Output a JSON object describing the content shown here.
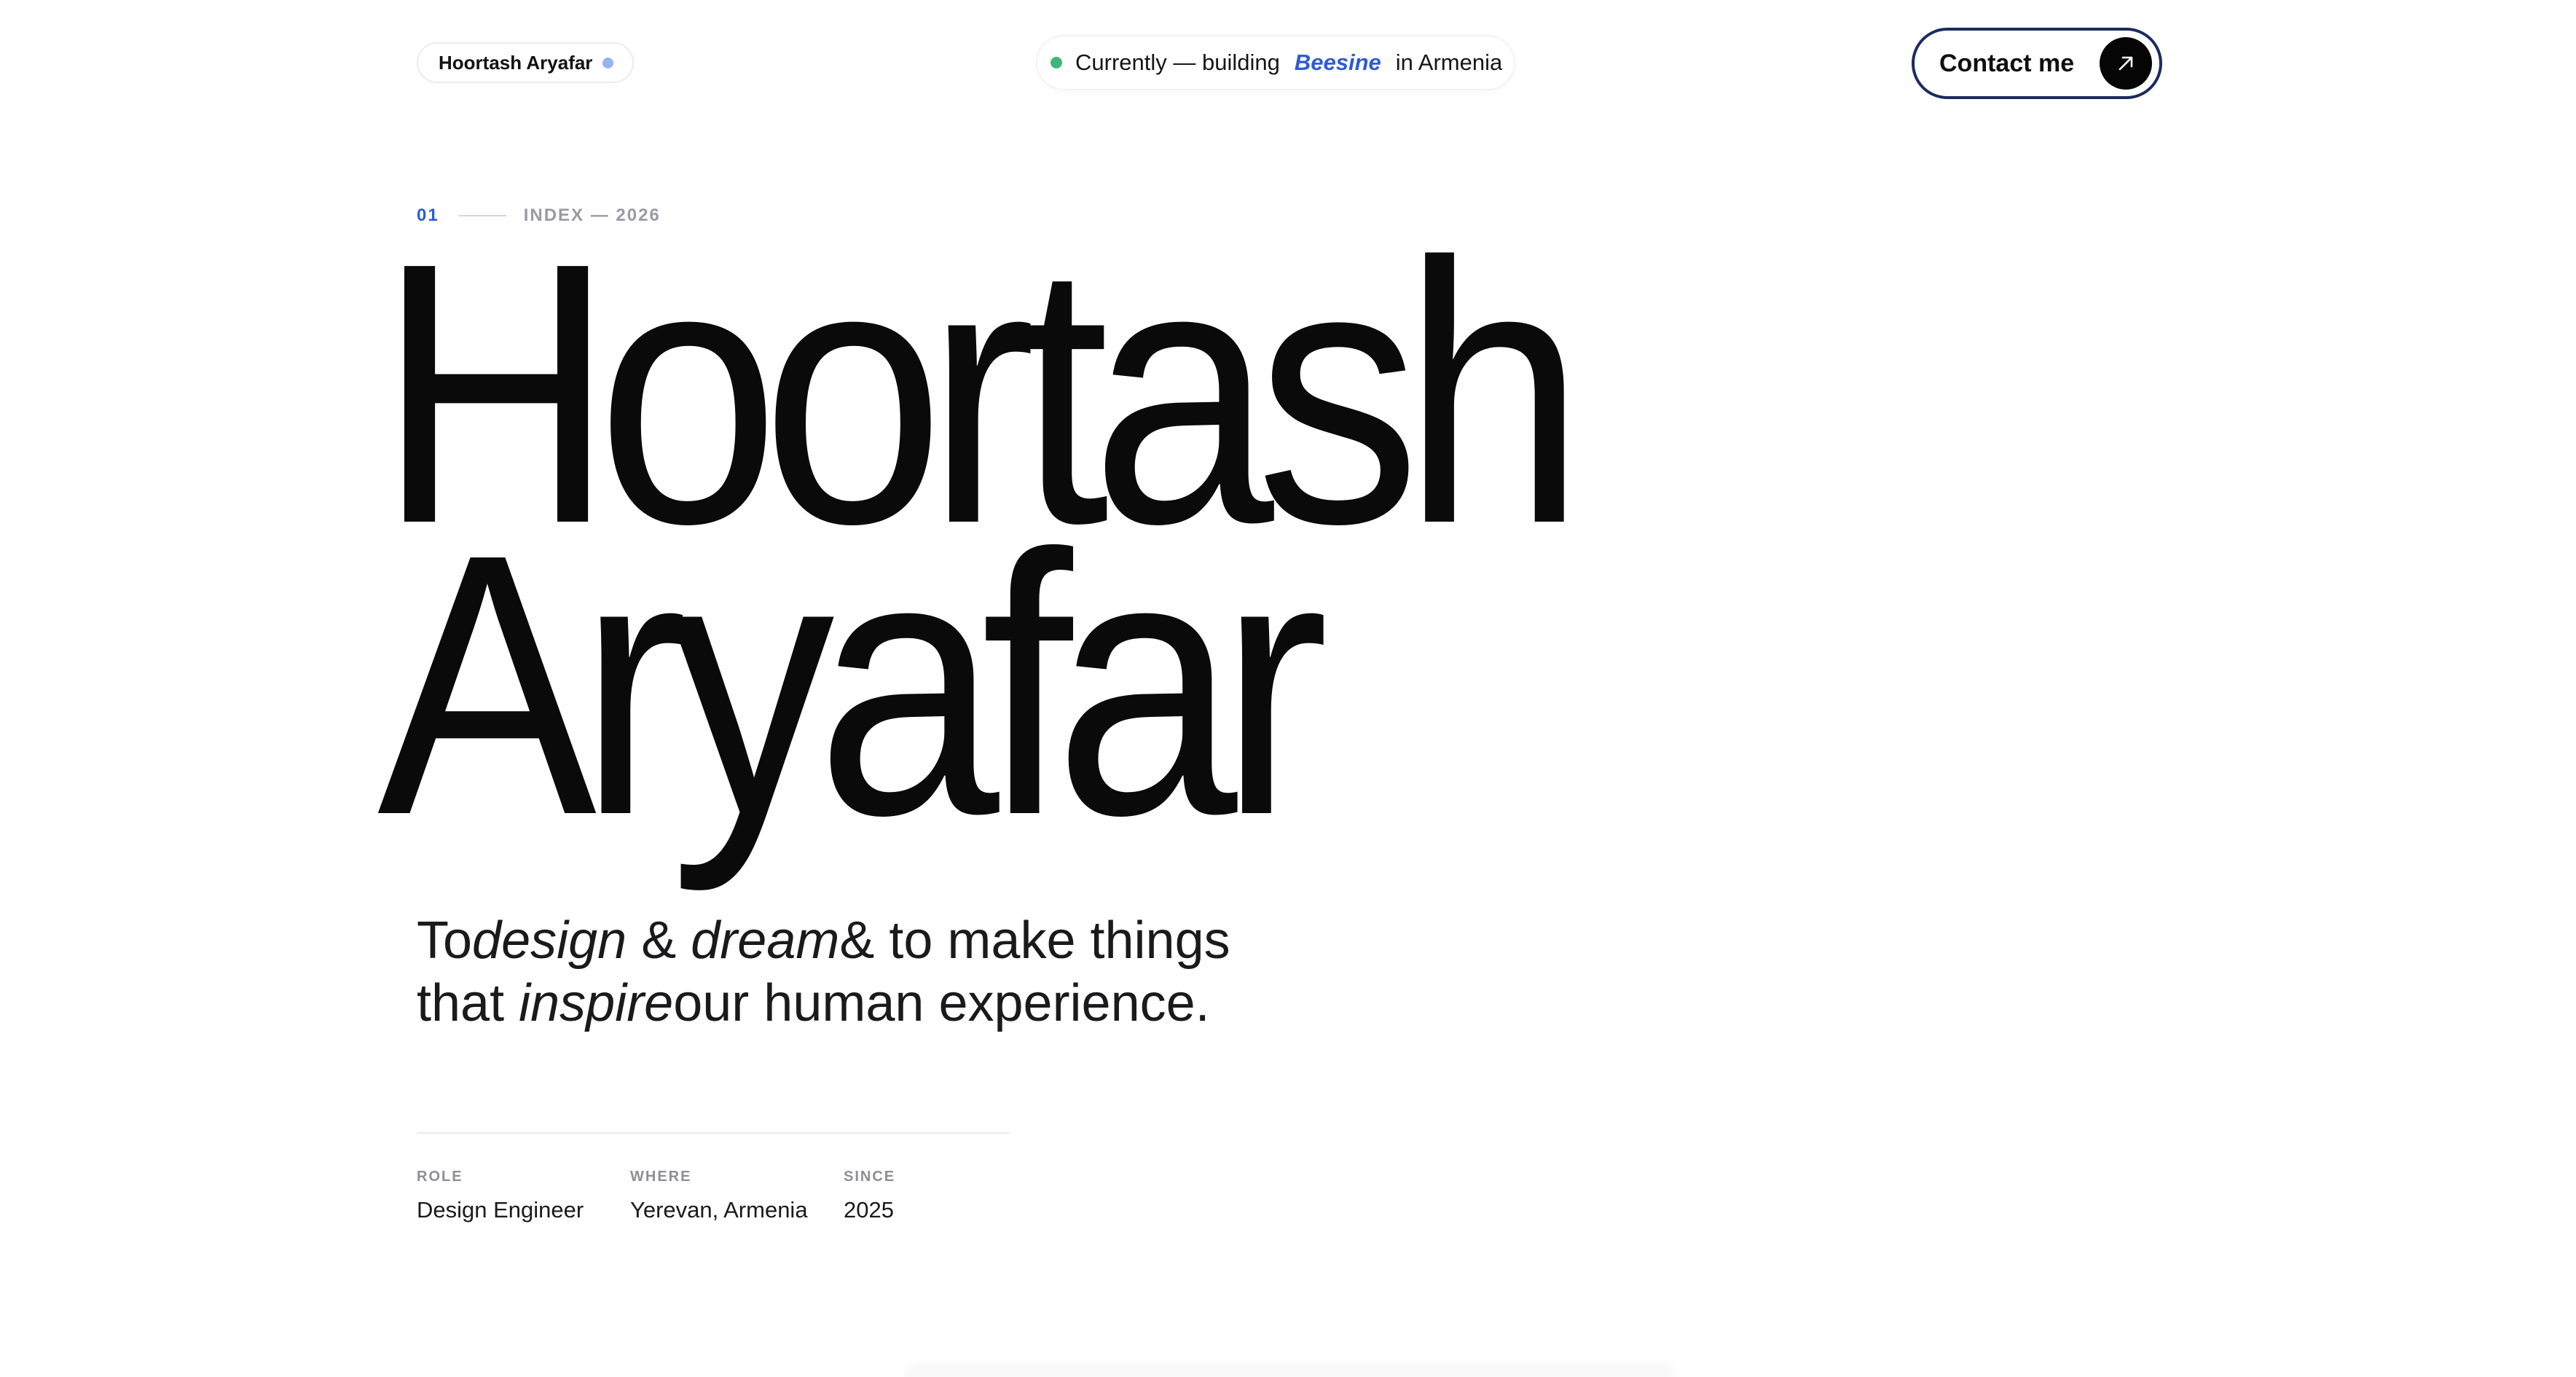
{
  "header": {
    "name_badge": "Hoortash Aryafar",
    "status": {
      "prefix": "Currently — building",
      "project": "Beesine",
      "suffix": "in Armenia",
      "live_color": "#3fb57a"
    },
    "contact_label": "Contact me",
    "contact_icon": "arrow-up-right-icon"
  },
  "index": {
    "number": "01",
    "label": "INDEX — 2026"
  },
  "hero": {
    "first_name": "Hoortash",
    "last_name": "Aryafar"
  },
  "tagline": {
    "part1": "To",
    "design": "design",
    "amp1": " & ",
    "dream": "dream",
    "part2": "& to make things",
    "part3": "that ",
    "inspire": "inspire",
    "part4": "our human experience."
  },
  "meta": {
    "role": {
      "label": "ROLE",
      "value": "Design Engineer"
    },
    "where": {
      "label": "WHERE",
      "value": "Yerevan, Armenia"
    },
    "since": {
      "label": "SINCE",
      "value": "2025"
    }
  },
  "colors": {
    "accent": "#2f5bd3",
    "text": "#0a0a0b",
    "contact_border": "#1c2a5e"
  }
}
